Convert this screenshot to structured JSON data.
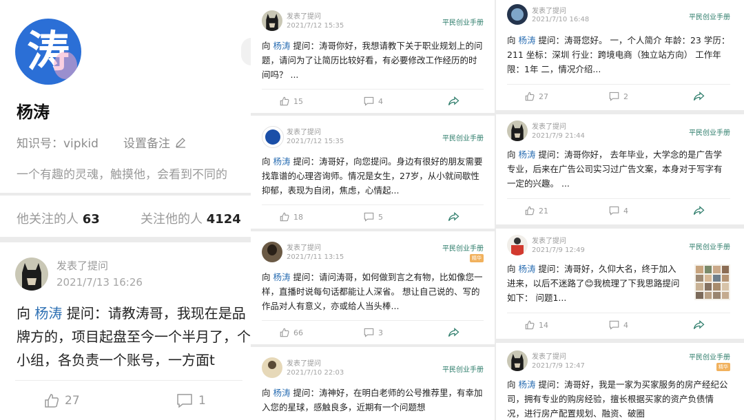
{
  "profile": {
    "avatar_char": "涛",
    "name": "杨涛",
    "zsxq_id": "知识号：vipkid",
    "remark_label": "设置备注",
    "bio": "一个有趣的灵魂，触摸他，会看到不同的",
    "following_label": "他关注的人",
    "following_count": "63",
    "followers_label": "关注他的人",
    "followers_count": "4124"
  },
  "posts": [
    {
      "action": "发表了提问",
      "time": "2021/7/13 16:26",
      "to": "向",
      "who": "杨涛",
      "ask": "提问：",
      "text": "请教涛哥，我现在是品牌方的，项目起盘至今一个半月了，个小组，各负责一个账号，一方面t",
      "likes": "27",
      "comments": "1"
    },
    {
      "action": "发表了提问",
      "time": "2021/7/12 15:35",
      "source": "平民创业手册",
      "to": "向",
      "who": "杨涛",
      "ask": "提问：",
      "text": "涛哥你好，我想请教下关于职业规划上的问题，请问为了让简历比较好看，有必要修改工作经历的时间吗？ ...",
      "likes": "15",
      "comments": "4"
    },
    {
      "action": "发表了提问",
      "time": "2021/7/12 15:35",
      "source": "平民创业手册",
      "to": "向",
      "who": "杨涛",
      "ask": "提问：",
      "text": "涛哥好，向您提问。身边有很好的朋友需要找靠谱的心理咨询师。情况是女生，27岁，从小就间歇性抑郁，表现为自闭，焦虑，心情起...",
      "likes": "18",
      "comments": "5"
    },
    {
      "action": "发表了提问",
      "time": "2021/7/11 13:15",
      "source": "平民创业手册",
      "tag": "精华",
      "to": "向",
      "who": "杨涛",
      "ask": "提问：",
      "text": "请问涛哥，如何做到言之有物，比如像您一样，直播时说每句话都能让人深省。 想让自己说的、写的作品对人有意义，亦或给人当头棒...",
      "likes": "66",
      "comments": "3"
    },
    {
      "action": "发表了提问",
      "time": "2021/7/10 22:03",
      "source": "平民创业手册",
      "to": "向",
      "who": "杨涛",
      "ask": "提问：",
      "text": "涛神好，在明白老师的公号推荐里，有幸加入您的星球，感触良多，近期有一个问题想"
    },
    {
      "action": "发表了提问",
      "time": "2021/7/10 16:48",
      "source": "平民创业手册",
      "to": "向",
      "who": "杨涛",
      "ask": "提问：",
      "text": "涛哥您好。 一，个人简介 年龄：23 学历：211 坐标：深圳 行业：跨境电商（独立站方向） 工作年限：1年 二，情况介绍...",
      "likes": "27",
      "comments": "2"
    },
    {
      "action": "发表了提问",
      "time": "2021/7/9 21:44",
      "source": "平民创业手册",
      "to": "向",
      "who": "杨涛",
      "ask": "提问：",
      "text": "涛哥你好， 去年毕业，大学念的是广告学专业，后来在广告公司实习过广告文案，本身对于写字有一定的兴趣。 ...",
      "likes": "21",
      "comments": "4"
    },
    {
      "action": "发表了提问",
      "time": "2021/7/9 12:49",
      "source": "平民创业手册",
      "to": "向",
      "who": "杨涛",
      "ask": "提问：",
      "text1": "涛哥好，久仰大名，终于加入进来，以后不迷路了",
      "emoji": "😊",
      "text2": "我梳理了下我思路提问如下： 问题1...",
      "likes": "14",
      "comments": "4"
    },
    {
      "action": "发表了提问",
      "time": "2021/7/9 12:47",
      "source": "平民创业手册",
      "tag": "精华",
      "to": "向",
      "who": "杨涛",
      "ask": "提问：",
      "text": "涛哥好，我是一家为买家服务的房产经纪公司，拥有专业的购房经验，擅长根据买家的资产负债情况，进行房产配置规划、融资、破圈"
    }
  ],
  "colors": {
    "link": "#2c6fb3",
    "accent_green": "#2e7d6b",
    "tag": "#f1b15d"
  }
}
